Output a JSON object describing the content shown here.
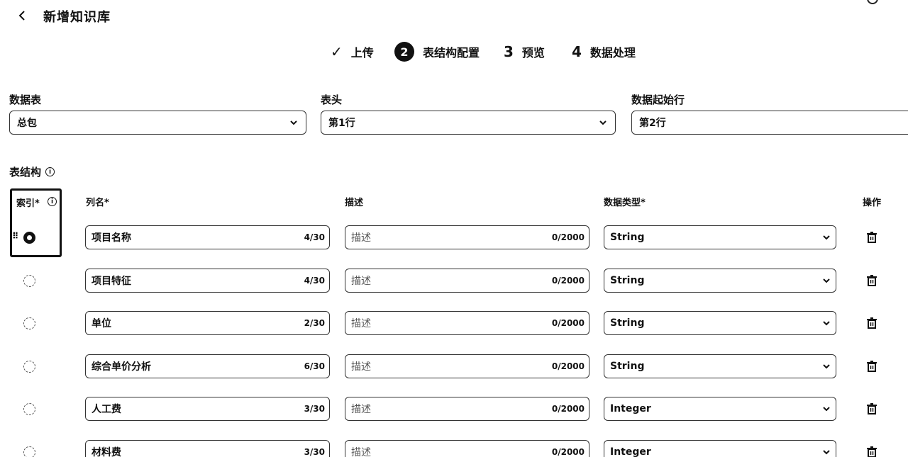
{
  "header": {
    "title": "新增知识库"
  },
  "steps": [
    {
      "indicator": "✓",
      "label": "上传"
    },
    {
      "indicator": "2",
      "label": "表结构配置"
    },
    {
      "indicator": "3",
      "label": "预览"
    },
    {
      "indicator": "4",
      "label": "数据处理"
    }
  ],
  "fields": {
    "sheet": {
      "label": "数据表",
      "value": "总包"
    },
    "header_row": {
      "label": "表头",
      "value": "第1行"
    },
    "data_start": {
      "label": "数据起始行",
      "value": "第2行"
    }
  },
  "structure": {
    "title": "表结构",
    "columns": {
      "index": "索引*",
      "name": "列名*",
      "desc": "描述",
      "type": "数据类型*",
      "action": "操作"
    },
    "rows": [
      {
        "name": "项目名称",
        "name_count": "4/30",
        "desc_placeholder": "描述",
        "desc_count": "0/2000",
        "type": "String",
        "indexed": true
      },
      {
        "name": "项目特征",
        "name_count": "4/30",
        "desc_placeholder": "描述",
        "desc_count": "0/2000",
        "type": "String",
        "indexed": false
      },
      {
        "name": "单位",
        "name_count": "2/30",
        "desc_placeholder": "描述",
        "desc_count": "0/2000",
        "type": "String",
        "indexed": false
      },
      {
        "name": "综合单价分析",
        "name_count": "6/30",
        "desc_placeholder": "描述",
        "desc_count": "0/2000",
        "type": "String",
        "indexed": false
      },
      {
        "name": "人工费",
        "name_count": "3/30",
        "desc_placeholder": "描述",
        "desc_count": "0/2000",
        "type": "Integer",
        "indexed": false
      },
      {
        "name": "材料费",
        "name_count": "3/30",
        "desc_placeholder": "描述",
        "desc_count": "0/2000",
        "type": "Integer",
        "indexed": false
      }
    ]
  }
}
